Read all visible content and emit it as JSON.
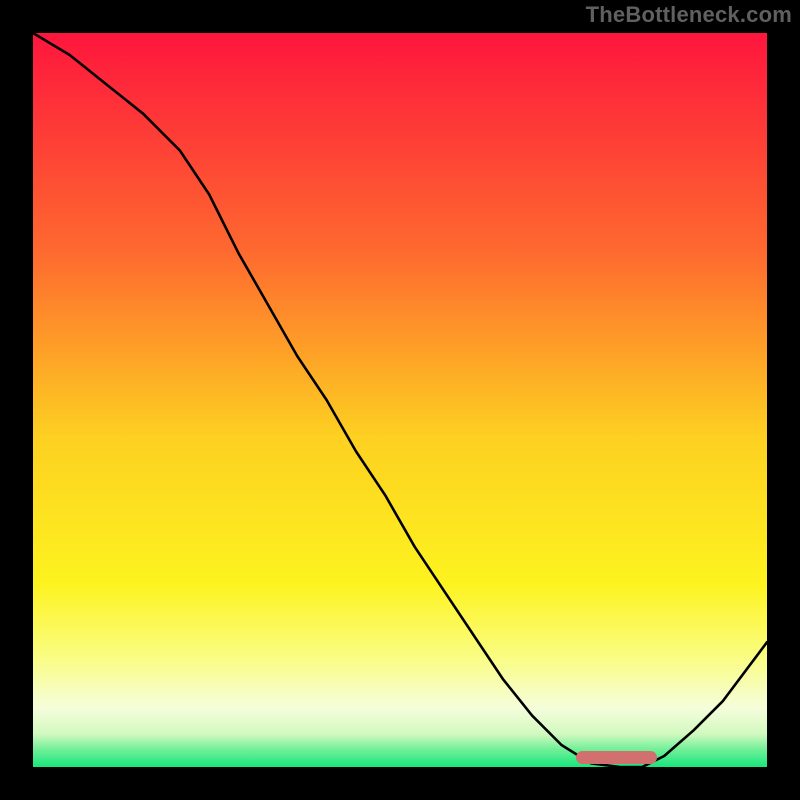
{
  "watermark": "TheBottleneck.com",
  "colors": {
    "top": "#fe163d",
    "mid_upper": "#fe9428",
    "mid": "#fdeb1e",
    "mid_lower": "#fafd82",
    "near_bottom": "#f5fddb",
    "bottom": "#16e77b",
    "curve": "#000000",
    "bar": "#d2706f",
    "frame": "#000000"
  },
  "chart_data": {
    "type": "line",
    "title": "",
    "xlabel": "",
    "ylabel": "",
    "xlim": [
      0,
      100
    ],
    "ylim": [
      0,
      100
    ],
    "x": [
      0,
      5,
      10,
      15,
      20,
      24,
      28,
      32,
      36,
      40,
      44,
      48,
      52,
      56,
      60,
      64,
      68,
      72,
      76,
      80,
      83,
      86,
      90,
      94,
      100
    ],
    "y": [
      100,
      97,
      93,
      89,
      84,
      78,
      70,
      63,
      56,
      50,
      43,
      37,
      30,
      24,
      18,
      12,
      7,
      3,
      0.5,
      0,
      0,
      1.5,
      5,
      9,
      17
    ],
    "optimal_range_x": [
      74,
      85
    ],
    "optimal_y": 1.4,
    "gradient_stops": [
      {
        "offset": 0.0,
        "color": "#fe163d"
      },
      {
        "offset": 0.3,
        "color": "#fe6a2f"
      },
      {
        "offset": 0.55,
        "color": "#fdd021"
      },
      {
        "offset": 0.75,
        "color": "#fdf31f"
      },
      {
        "offset": 0.85,
        "color": "#fafd82"
      },
      {
        "offset": 0.92,
        "color": "#f5fddb"
      },
      {
        "offset": 0.955,
        "color": "#d2f9bf"
      },
      {
        "offset": 0.975,
        "color": "#76f09a"
      },
      {
        "offset": 1.0,
        "color": "#16e77b"
      }
    ]
  }
}
